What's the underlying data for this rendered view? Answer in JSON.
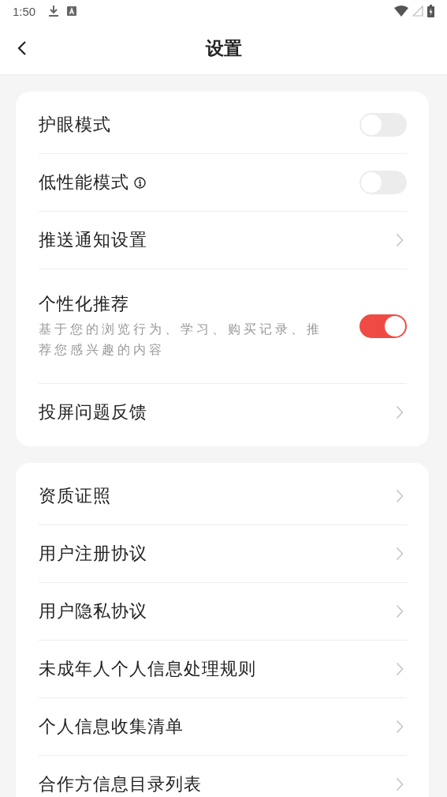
{
  "status_bar": {
    "time": "1:50"
  },
  "header": {
    "title": "设置"
  },
  "groups": [
    {
      "items": [
        {
          "kind": "toggle",
          "label": "护眼模式",
          "on": false
        },
        {
          "kind": "toggle",
          "label": "低性能模式",
          "on": false,
          "info": true
        },
        {
          "kind": "link",
          "label": "推送通知设置"
        },
        {
          "kind": "toggle",
          "label": "个性化推荐",
          "on": true,
          "description": "基于您的浏览行为、学习、购买记录、推荐您感兴趣的内容"
        },
        {
          "kind": "link",
          "label": "投屏问题反馈"
        }
      ]
    },
    {
      "items": [
        {
          "kind": "link",
          "label": "资质证照"
        },
        {
          "kind": "link",
          "label": "用户注册协议"
        },
        {
          "kind": "link",
          "label": "用户隐私协议"
        },
        {
          "kind": "link",
          "label": "未成年人个人信息处理规则"
        },
        {
          "kind": "link",
          "label": "个人信息收集清单"
        },
        {
          "kind": "link",
          "label": "合作方信息目录列表"
        }
      ]
    }
  ]
}
